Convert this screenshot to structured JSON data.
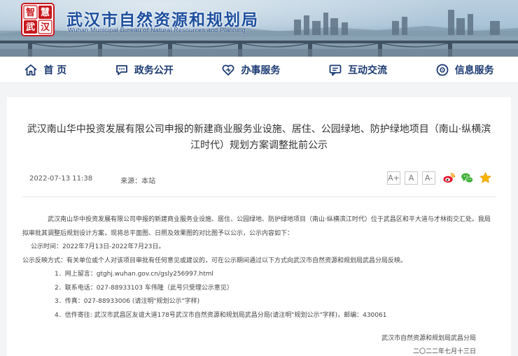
{
  "header": {
    "logo_chars": [
      "智",
      "慧",
      "武",
      "汉"
    ],
    "site_title": "武汉市自然资源和规划局",
    "site_subtitle": "Wuhan Municipal Bureau of Natural Resources and Planning"
  },
  "nav": {
    "items": [
      {
        "label": "首 页",
        "icon": "home-icon"
      },
      {
        "label": "政务公开",
        "icon": "chat-icon"
      },
      {
        "label": "办事服务",
        "icon": "heart-icon"
      },
      {
        "label": "互动交流",
        "icon": "comment-icon"
      },
      {
        "label": "信息服务",
        "icon": "info-icon"
      }
    ]
  },
  "article": {
    "title": "武汉南山华中投资发展有限公司申报的新建商业服务业设施、居住、公园绿地、防护绿地项目（南山·纵横滨江时代）规划方案调整批前公示",
    "date": "2022-07-13 11:38",
    "source": "来源：本站",
    "font_sizes": [
      "A+",
      "A",
      "A-"
    ],
    "share_icons": [
      "weibo-icon",
      "wechat-icon",
      "favorite-icon"
    ],
    "paragraph1": "武汉南山华中投资发展有限公司申报的新建商业服务业设施、居住、公园绿地、防护绿地项目（南山·纵横滨江时代）位于武昌区和平大道与才林街交汇处。我局拟审批其调整后规划设计方案，现将总平面图、日照及效果图的对比图予以公示，公示内容如下：",
    "period": "公示时间：2022年7月13日-2022年7月23日。",
    "feedback": "公示反映方式：有关单位或个人对该项目审批有任何意见或建议的，可在公示期间通过以下方式向武汉市自然资源和规划局武昌分局反映。",
    "list": [
      "1．网上留言：gtghj.wuhan.gov.cn/gsly256997.html",
      "2．联系电话：027-88933103  车伟隆（此号只受理公示意见）",
      "3．传真：027-88933006 (请注明\"规划公示\"字样)",
      "4．信件寄往: 武汉市武昌区友谊大道178号武汉市自然资源和规划局武昌分局(请注明\"规划公示\"字样)，邮编：430061"
    ],
    "signature": "武汉市自然资源和规划局武昌分局",
    "sign_date": "二〇二二年七月十三日"
  },
  "colors": {
    "nav_text": "#1b3a73",
    "title_blue": "#1d4f9e",
    "logo_red": "#c8171e"
  }
}
